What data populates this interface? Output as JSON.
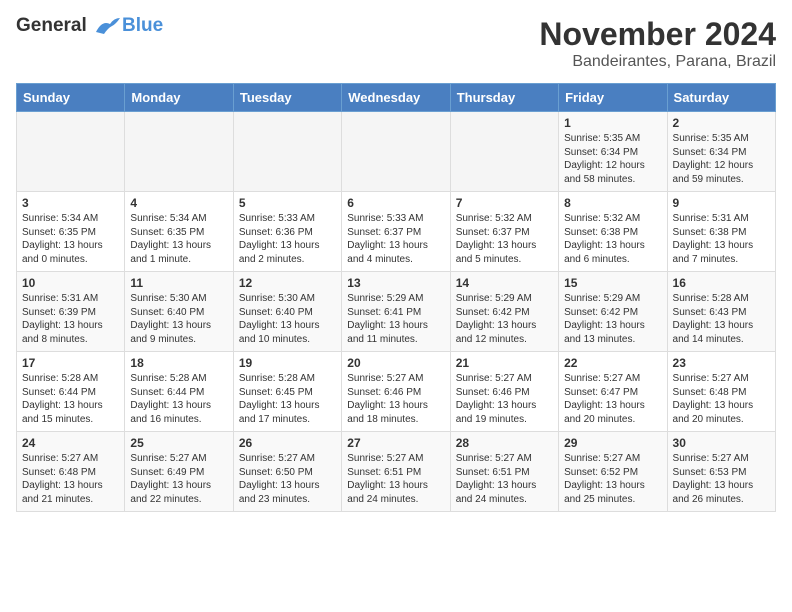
{
  "header": {
    "logo_line1": "General",
    "logo_line2": "Blue",
    "month": "November 2024",
    "location": "Bandeirantes, Parana, Brazil"
  },
  "weekdays": [
    "Sunday",
    "Monday",
    "Tuesday",
    "Wednesday",
    "Thursday",
    "Friday",
    "Saturday"
  ],
  "weeks": [
    [
      {
        "day": "",
        "info": ""
      },
      {
        "day": "",
        "info": ""
      },
      {
        "day": "",
        "info": ""
      },
      {
        "day": "",
        "info": ""
      },
      {
        "day": "",
        "info": ""
      },
      {
        "day": "1",
        "info": "Sunrise: 5:35 AM\nSunset: 6:34 PM\nDaylight: 12 hours\nand 58 minutes."
      },
      {
        "day": "2",
        "info": "Sunrise: 5:35 AM\nSunset: 6:34 PM\nDaylight: 12 hours\nand 59 minutes."
      }
    ],
    [
      {
        "day": "3",
        "info": "Sunrise: 5:34 AM\nSunset: 6:35 PM\nDaylight: 13 hours\nand 0 minutes."
      },
      {
        "day": "4",
        "info": "Sunrise: 5:34 AM\nSunset: 6:35 PM\nDaylight: 13 hours\nand 1 minute."
      },
      {
        "day": "5",
        "info": "Sunrise: 5:33 AM\nSunset: 6:36 PM\nDaylight: 13 hours\nand 2 minutes."
      },
      {
        "day": "6",
        "info": "Sunrise: 5:33 AM\nSunset: 6:37 PM\nDaylight: 13 hours\nand 4 minutes."
      },
      {
        "day": "7",
        "info": "Sunrise: 5:32 AM\nSunset: 6:37 PM\nDaylight: 13 hours\nand 5 minutes."
      },
      {
        "day": "8",
        "info": "Sunrise: 5:32 AM\nSunset: 6:38 PM\nDaylight: 13 hours\nand 6 minutes."
      },
      {
        "day": "9",
        "info": "Sunrise: 5:31 AM\nSunset: 6:38 PM\nDaylight: 13 hours\nand 7 minutes."
      }
    ],
    [
      {
        "day": "10",
        "info": "Sunrise: 5:31 AM\nSunset: 6:39 PM\nDaylight: 13 hours\nand 8 minutes."
      },
      {
        "day": "11",
        "info": "Sunrise: 5:30 AM\nSunset: 6:40 PM\nDaylight: 13 hours\nand 9 minutes."
      },
      {
        "day": "12",
        "info": "Sunrise: 5:30 AM\nSunset: 6:40 PM\nDaylight: 13 hours\nand 10 minutes."
      },
      {
        "day": "13",
        "info": "Sunrise: 5:29 AM\nSunset: 6:41 PM\nDaylight: 13 hours\nand 11 minutes."
      },
      {
        "day": "14",
        "info": "Sunrise: 5:29 AM\nSunset: 6:42 PM\nDaylight: 13 hours\nand 12 minutes."
      },
      {
        "day": "15",
        "info": "Sunrise: 5:29 AM\nSunset: 6:42 PM\nDaylight: 13 hours\nand 13 minutes."
      },
      {
        "day": "16",
        "info": "Sunrise: 5:28 AM\nSunset: 6:43 PM\nDaylight: 13 hours\nand 14 minutes."
      }
    ],
    [
      {
        "day": "17",
        "info": "Sunrise: 5:28 AM\nSunset: 6:44 PM\nDaylight: 13 hours\nand 15 minutes."
      },
      {
        "day": "18",
        "info": "Sunrise: 5:28 AM\nSunset: 6:44 PM\nDaylight: 13 hours\nand 16 minutes."
      },
      {
        "day": "19",
        "info": "Sunrise: 5:28 AM\nSunset: 6:45 PM\nDaylight: 13 hours\nand 17 minutes."
      },
      {
        "day": "20",
        "info": "Sunrise: 5:27 AM\nSunset: 6:46 PM\nDaylight: 13 hours\nand 18 minutes."
      },
      {
        "day": "21",
        "info": "Sunrise: 5:27 AM\nSunset: 6:46 PM\nDaylight: 13 hours\nand 19 minutes."
      },
      {
        "day": "22",
        "info": "Sunrise: 5:27 AM\nSunset: 6:47 PM\nDaylight: 13 hours\nand 20 minutes."
      },
      {
        "day": "23",
        "info": "Sunrise: 5:27 AM\nSunset: 6:48 PM\nDaylight: 13 hours\nand 20 minutes."
      }
    ],
    [
      {
        "day": "24",
        "info": "Sunrise: 5:27 AM\nSunset: 6:48 PM\nDaylight: 13 hours\nand 21 minutes."
      },
      {
        "day": "25",
        "info": "Sunrise: 5:27 AM\nSunset: 6:49 PM\nDaylight: 13 hours\nand 22 minutes."
      },
      {
        "day": "26",
        "info": "Sunrise: 5:27 AM\nSunset: 6:50 PM\nDaylight: 13 hours\nand 23 minutes."
      },
      {
        "day": "27",
        "info": "Sunrise: 5:27 AM\nSunset: 6:51 PM\nDaylight: 13 hours\nand 24 minutes."
      },
      {
        "day": "28",
        "info": "Sunrise: 5:27 AM\nSunset: 6:51 PM\nDaylight: 13 hours\nand 24 minutes."
      },
      {
        "day": "29",
        "info": "Sunrise: 5:27 AM\nSunset: 6:52 PM\nDaylight: 13 hours\nand 25 minutes."
      },
      {
        "day": "30",
        "info": "Sunrise: 5:27 AM\nSunset: 6:53 PM\nDaylight: 13 hours\nand 26 minutes."
      }
    ]
  ]
}
